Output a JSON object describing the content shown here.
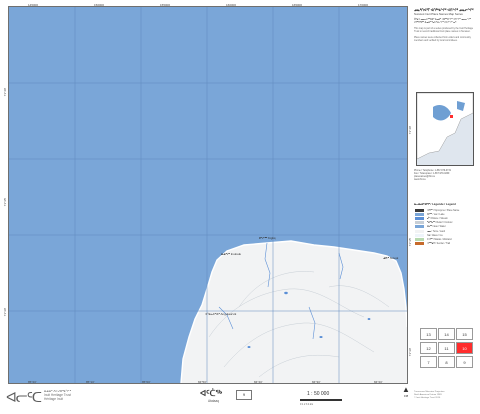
{
  "map": {
    "top_coords": [
      "145000",
      "150000",
      "155000",
      "160000",
      "165000",
      "170000",
      "175000"
    ],
    "bottom_coords": [
      "85°20'",
      "85°10'",
      "85°00'",
      "84°50'",
      "84°40'",
      "84°30'",
      "84°20'"
    ],
    "left_coords": [
      "71°40'",
      "71°35'",
      "71°30'"
    ],
    "right_coords": [
      "71°40'",
      "71°35'",
      "71°30'"
    ],
    "place_labels": [
      {
        "text": "ᐃᓄᒃᓱᒃ Inuksuk"
      },
      {
        "text": "ᑭᒡᓕᖅ Kigliq"
      },
      {
        "text": "ᓄᕗᒃ Nuvuk"
      },
      {
        "text": "ᐊᖑᓚᐅᕐᕕᒃ Angulaurvik"
      }
    ],
    "colors": {
      "water": "#7aa6d8",
      "land": "#f2f3f4",
      "shore": "#ffffff",
      "grid": "#5f88bd",
      "contour": "#c8cfd6",
      "stream": "#5b8fd6"
    }
  },
  "panel": {
    "title": "ᓄᓇᑦᑎᐊᕐᒥ ᐊᑎᖅᑲᖏᑦ ᐊᑎᖏᑦ ᓄᓇᓕᖏᑦ",
    "subtitle": "Nunavut Inuit Place Names Map Series",
    "paragraphs": [
      "ᑖᒃᑯᐊ ᓄᓇᓕᐅᖅᑕᐃᑦ ᐃᓄᐃᑦ ᐊᑐᖅᑕᖏᑦ ᐊᑎᖏᑦ ᓄᓇᓕᖏᑦ ᓴᕿᑎᑦᑐᖅ ᐃᓄᐃᑦ ᖃᐅᔨᒪᔭᖏᑦ ᐱᐅᓯᖏᓐᓂᒃ.",
      "This map is part of a series produced by the Inuit Heritage Trust to record traditional Inuit place names in Nunavut.",
      "Place names were collected from elders and community members and verified by local committees."
    ],
    "contacts": [
      "Phone / Téléphone: 1-867-979-0731",
      "Fax / Télécopieur: 1-867-979-0269",
      "placenames@ihti.ca",
      "www.ihti.ca"
    ],
    "legend_title": "ᓇᓗᓇᐃᔭᕈᑎᑦ / Légende / Legend",
    "legend": [
      {
        "label": "ᐊᑎᖅ / Toponyme / Place Name",
        "color": "#3a3a3a"
      },
      {
        "label": "ᑕᓯᖅ / Lac / Lake",
        "color": "#7aa6d8"
      },
      {
        "label": "ᑰᒃ / Rivière / Stream",
        "color": "#5b8fd6"
      },
      {
        "label": "ᖃᖅᑲᖅ / Relief / Contour",
        "color": "#c8cfd6"
      },
      {
        "label": "ᐃᒪᖅ / Eau / Water",
        "color": "#7aa6d8"
      },
      {
        "label": "ᓄᓇ / Terre / Land",
        "color": "#f2f3f4"
      },
      {
        "label": "ᓯᑯ / Glace / Ice",
        "color": "#eef4fa"
      },
      {
        "label": "ᐅᐊᖅ / Marais / Wetland",
        "color": "#b7d9b0"
      },
      {
        "label": "ᐊᖅᖁᑎ / Sentier / Trail",
        "color": "#c66a2b"
      }
    ],
    "index_cells": [
      "13",
      "14",
      "15",
      "12",
      "11",
      "10",
      "7",
      "8",
      "9"
    ],
    "index_highlight": "#ff2d2d",
    "notes": [
      "Transverse Mercator Projection",
      "North American Datum 1983",
      "© Inuit Heritage Trust 2016"
    ]
  },
  "footer": {
    "logo_text": "ᐊᓕᑦᑕ",
    "org_lines": [
      "ᐃᓄᐃᑦ ᐱᐅᓯᑐᖃᖏᑦ",
      "Inuit Heritage Trust",
      "Héritage Inuit"
    ],
    "sheet_syllabics": "ᐊᑦᑖᖅ",
    "sheet_name": "Atataaq",
    "sheet_number": "9",
    "scale": "1 : 50 000",
    "scale_units": "0   1   2   3   4 km",
    "north_label": "ᐅᑭ"
  }
}
